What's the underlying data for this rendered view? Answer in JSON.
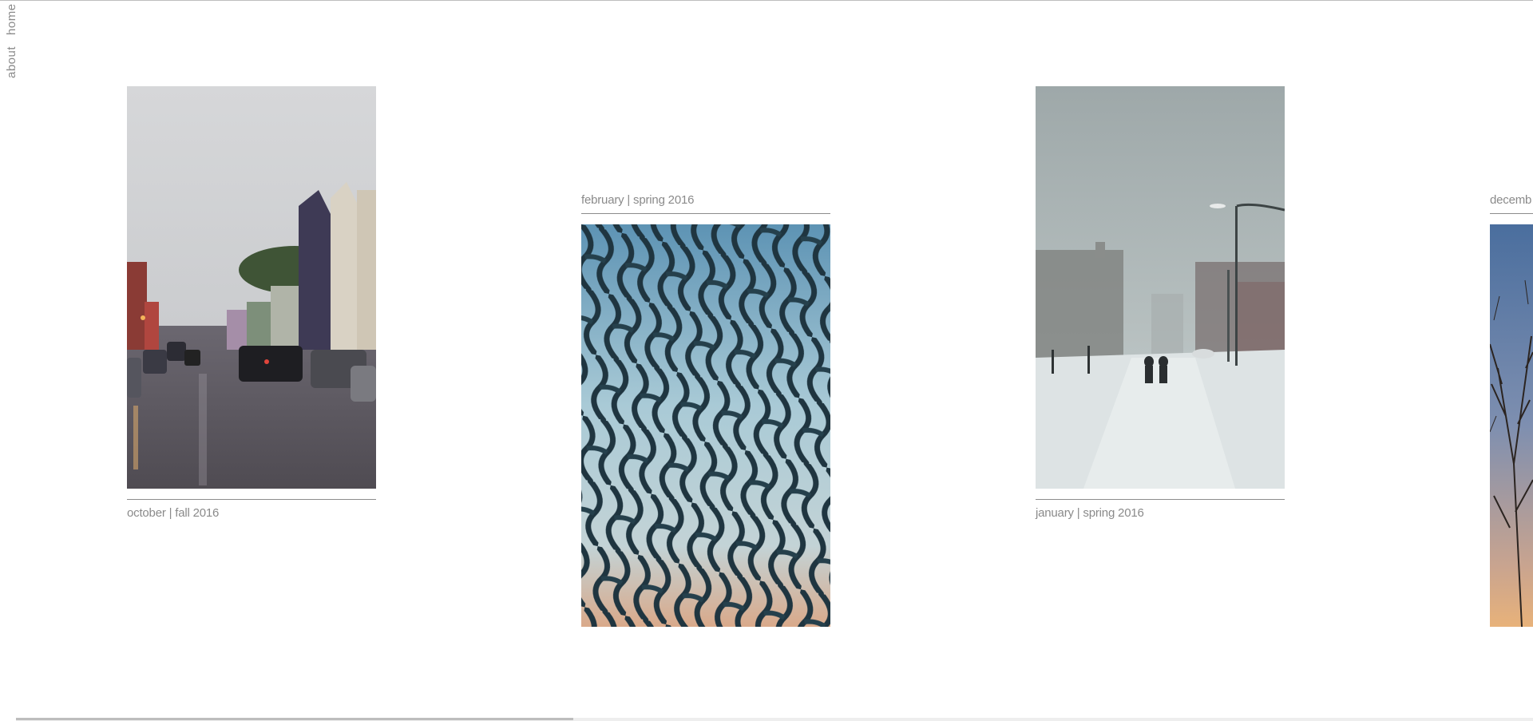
{
  "nav": {
    "home_label": "home",
    "about_label": "about"
  },
  "gallery": {
    "items": [
      {
        "caption": "october | fall 2016",
        "image": "rainy-street-rowhouses"
      },
      {
        "caption": "february | spring 2016",
        "image": "chain-link-fence-sky"
      },
      {
        "caption": "january | spring 2016",
        "image": "snowy-street-walkers"
      },
      {
        "caption": "decemb",
        "image": "bare-tree-sunset"
      }
    ]
  },
  "scroll": {
    "horizontal_position": 0.0
  },
  "colors": {
    "caption_text": "#8a8a8a",
    "rule": "#8c8c8c",
    "background": "#ffffff"
  }
}
